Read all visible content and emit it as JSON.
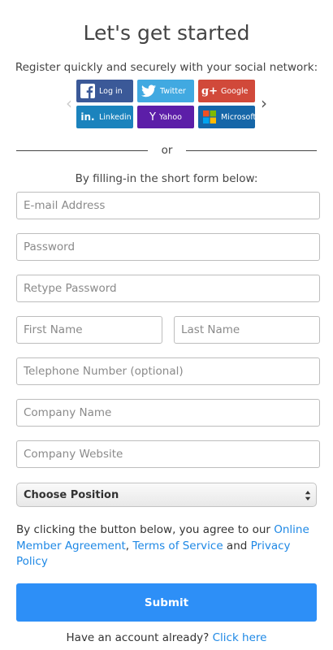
{
  "header": {
    "title": "Let's get started",
    "social_prompt": "Register quickly and securely with your social network:"
  },
  "social": {
    "buttons": [
      {
        "id": "facebook",
        "label": "Log in",
        "icon": "facebook-icon",
        "color": "#3b5998"
      },
      {
        "id": "twitter",
        "label": "Twitter",
        "icon": "twitter-icon",
        "color": "#41a9e1"
      },
      {
        "id": "google",
        "label": "Google",
        "icon": "google-plus-icon",
        "color": "#d1493a"
      },
      {
        "id": "linkedin",
        "label": "Linkedin",
        "icon": "linkedin-icon",
        "color": "#1b83bd"
      },
      {
        "id": "yahoo",
        "label": "Yahoo",
        "icon": "yahoo-icon",
        "color": "#5c1ea8"
      },
      {
        "id": "microsoft",
        "label": "Microsoft",
        "icon": "microsoft-icon",
        "color": "#1566a8"
      }
    ],
    "prev_icon": "chevron-left-icon",
    "next_icon": "chevron-right-icon"
  },
  "divider": {
    "text": "or"
  },
  "form": {
    "lead": "By filling-in the short form below:",
    "fields": {
      "email": {
        "placeholder": "E-mail Address",
        "value": ""
      },
      "password": {
        "placeholder": "Password",
        "value": ""
      },
      "retype_password": {
        "placeholder": "Retype Password",
        "value": ""
      },
      "first_name": {
        "placeholder": "First Name",
        "value": ""
      },
      "last_name": {
        "placeholder": "Last Name",
        "value": ""
      },
      "telephone": {
        "placeholder": "Telephone Number (optional)",
        "value": ""
      },
      "company_name": {
        "placeholder": "Company Name",
        "value": ""
      },
      "company_website": {
        "placeholder": "Company Website",
        "value": ""
      }
    },
    "position_select": {
      "selected": "Choose Position"
    },
    "agreement": {
      "prefix": "By clicking the button below, you agree to our ",
      "link1": "Online Member Agreement",
      "sep1": ", ",
      "link2": "Terms of Service",
      "sep2": " and ",
      "link3": "Privacy Policy"
    },
    "submit_label": "Submit"
  },
  "footer": {
    "prompt": "Have an account already? ",
    "link": "Click here"
  },
  "colors": {
    "accent": "#2d8ff7",
    "link": "#1e88e5"
  }
}
